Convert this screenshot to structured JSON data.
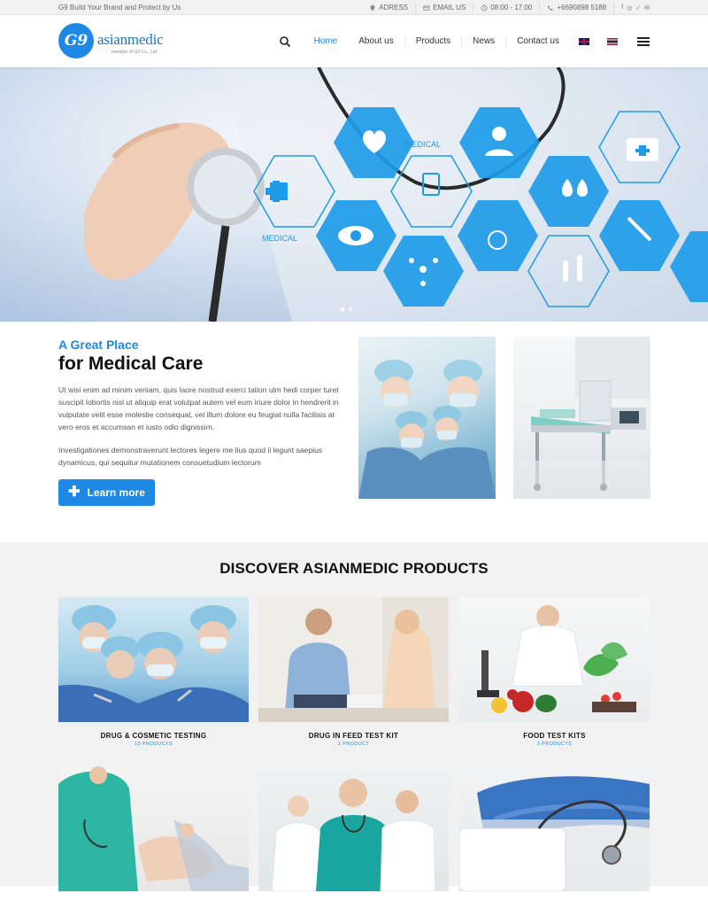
{
  "topbar": {
    "tagline": "G9 Build Your Brand and Protect by Us",
    "address": "ADRESS",
    "email": "EMAIL US",
    "hours": "08:00 - 17:00",
    "phone": "+6690898 5188",
    "social_icons": [
      "facebook-icon",
      "instagram-icon",
      "twitter-icon",
      "mail-icon"
    ]
  },
  "header": {
    "logo_badge": "G9",
    "logo_name": "asianmedic",
    "logo_sub": "member of G9 Co., Ltd",
    "nav": [
      "Home",
      "About us",
      "Products",
      "News",
      "Contact us"
    ],
    "active_nav": "Home",
    "languages": [
      "English",
      "Thai"
    ]
  },
  "hero": {
    "labels": [
      "MEDICAL",
      "MEDICAL"
    ],
    "slides": 2,
    "active_slide": 1
  },
  "intro": {
    "eyebrow": "A Great Place",
    "title": "for Medical Care",
    "p1": "Ut wisi enim ad minim veniam, quis laore nostrud exerci tation ulm hedi corper turet suscipit lobortis nisl ut aliquip erat volutpat autem vel eum iriure dolor in hendrerit in vulputate velit esse molestie consequat, vel illum dolore eu feugiat nulla facilisis at vero eros et accumsan et iusto odio dignissim.",
    "p2": "Investigationes demonstraverunt lectores legere me lius quod ii legunt saepius dynamicus, qui sequitur mutationem consuetudium lectorum",
    "button": "Learn more"
  },
  "products": {
    "heading": "DISCOVER ASIANMEDIC PRODUCTS",
    "items": [
      {
        "title": "DRUG & COSMETIC TESTING",
        "count": "10 PRODUCTS"
      },
      {
        "title": "DRUG IN FEED TEST KIT",
        "count": "1 PRODUCT"
      },
      {
        "title": "FOOD TEST KITS",
        "count": "3 PRODUCTS"
      },
      {
        "title": "",
        "count": ""
      },
      {
        "title": "",
        "count": ""
      },
      {
        "title": "",
        "count": ""
      }
    ]
  },
  "colors": {
    "accent": "#1e88e5",
    "hero_hex": "#1e9be8",
    "section_bg": "#f1f1f1"
  }
}
